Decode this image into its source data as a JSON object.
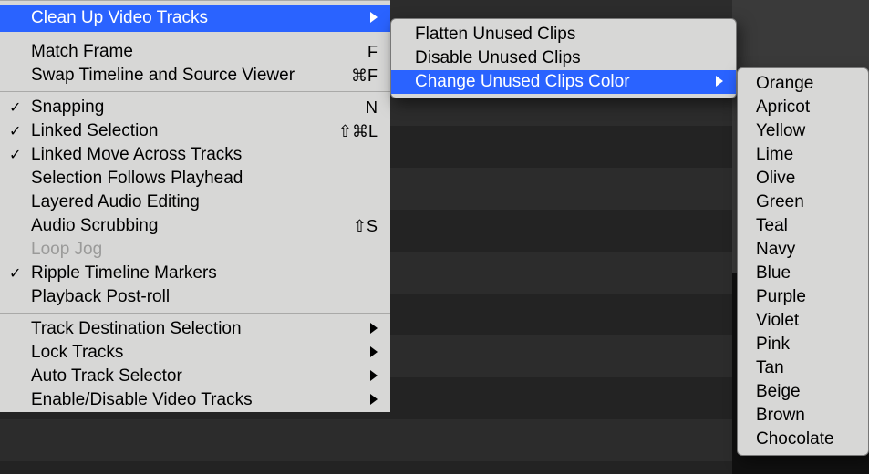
{
  "mainMenu": {
    "items": [
      {
        "label": "Clean Up Video Tracks",
        "highlight": true,
        "submenu": true
      },
      {
        "sep": true
      },
      {
        "label": "Match Frame",
        "shortcut": "F"
      },
      {
        "label": "Swap Timeline and Source Viewer",
        "shortcut": "⌘F"
      },
      {
        "sep": true
      },
      {
        "label": "Snapping",
        "shortcut": "N",
        "check": true
      },
      {
        "label": "Linked Selection",
        "shortcut": "⇧⌘L",
        "check": true
      },
      {
        "label": "Linked Move Across Tracks",
        "check": true
      },
      {
        "label": "Selection Follows Playhead"
      },
      {
        "label": "Layered Audio Editing"
      },
      {
        "label": "Audio Scrubbing",
        "shortcut": "⇧S"
      },
      {
        "label": "Loop Jog",
        "disabled": true
      },
      {
        "label": "Ripple Timeline Markers",
        "check": true
      },
      {
        "label": "Playback Post-roll"
      },
      {
        "sep": true
      },
      {
        "label": "Track Destination Selection",
        "submenu": true
      },
      {
        "label": "Lock Tracks",
        "submenu": true
      },
      {
        "label": "Auto Track Selector",
        "submenu": true
      },
      {
        "label": "Enable/Disable Video Tracks",
        "submenu": true
      }
    ]
  },
  "submenu1": {
    "items": [
      {
        "label": "Flatten Unused Clips"
      },
      {
        "label": "Disable Unused Clips"
      },
      {
        "label": "Change Unused Clips Color",
        "highlight": true,
        "submenu": true
      }
    ]
  },
  "submenu2": {
    "items": [
      {
        "label": "Orange"
      },
      {
        "label": "Apricot"
      },
      {
        "label": "Yellow"
      },
      {
        "label": "Lime"
      },
      {
        "label": "Olive"
      },
      {
        "label": "Green"
      },
      {
        "label": "Teal"
      },
      {
        "label": "Navy"
      },
      {
        "label": "Blue"
      },
      {
        "label": "Purple"
      },
      {
        "label": "Violet"
      },
      {
        "label": "Pink"
      },
      {
        "label": "Tan"
      },
      {
        "label": "Beige"
      },
      {
        "label": "Brown"
      },
      {
        "label": "Chocolate"
      }
    ]
  }
}
